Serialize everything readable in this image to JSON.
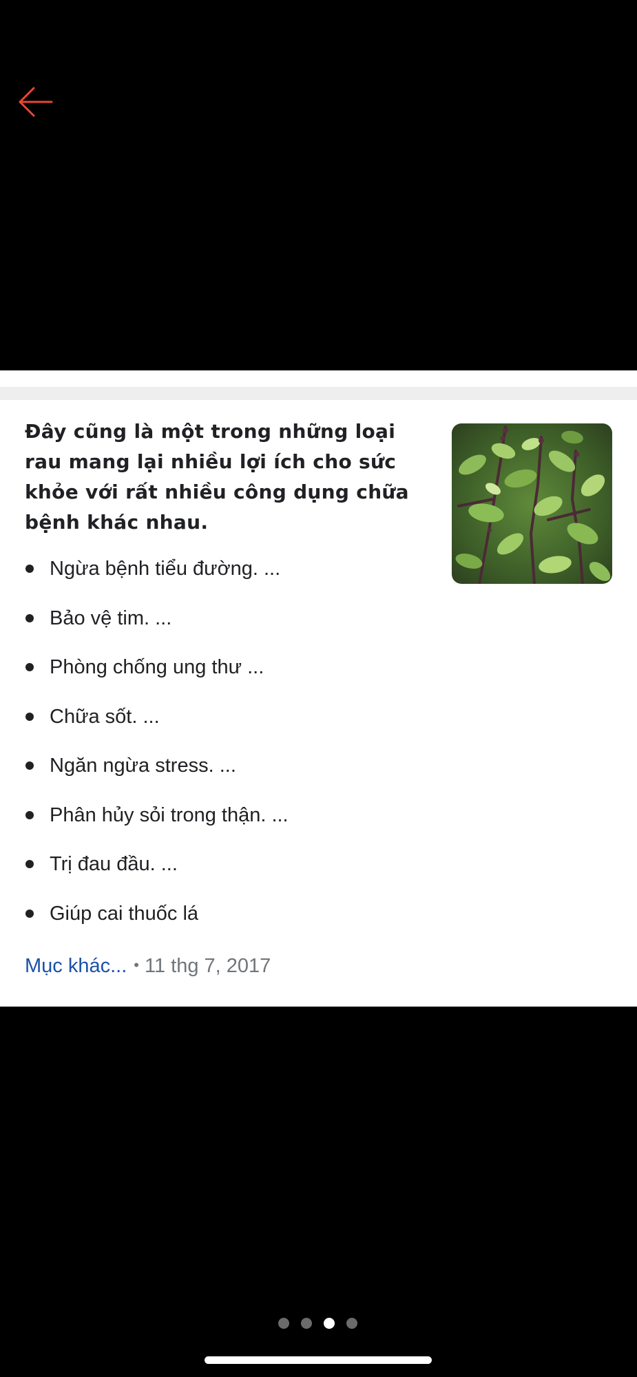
{
  "header": {
    "back_icon": "arrow-left-icon",
    "accent_color": "#e8472f"
  },
  "card": {
    "intro_text": "Đây cũng là một trong những loại rau mang lại nhiều lợi ích cho sức khỏe với rất nhiều công dụng chữa bệnh khác nhau.",
    "image_description": "basil-plant-photo",
    "benefits": [
      "Ngừa bệnh tiểu đường. ...",
      "Bảo vệ tim. ...",
      "Phòng chống ung thư ...",
      "Chữa sốt. ...",
      "Ngăn ngừa stress. ...",
      "Phân hủy sỏi trong thận. ...",
      "Trị đau đầu. ...",
      "Giúp cai thuốc lá"
    ],
    "more_link": "Mục khác...",
    "separator": "•",
    "date": "11 thg 7, 2017",
    "link_color": "#1a52a8"
  },
  "pager": {
    "count": 4,
    "active_index": 2
  }
}
